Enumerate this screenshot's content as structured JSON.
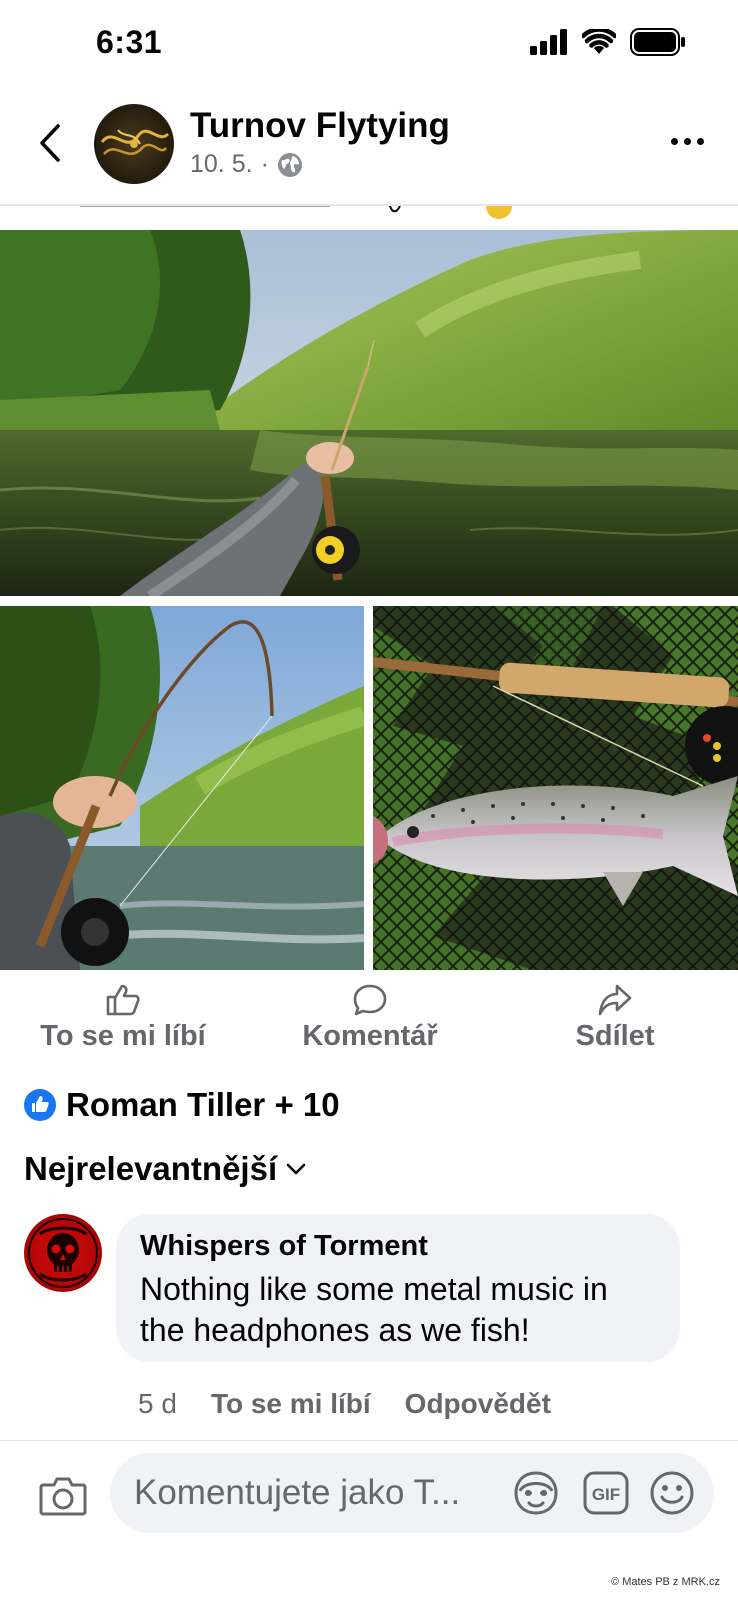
{
  "status_bar": {
    "time": "6:31"
  },
  "header": {
    "page_name": "Turnov Flytying",
    "date": "10. 5.",
    "separator": "·"
  },
  "photos": [
    {
      "icon": "river-fly-fishing-photo"
    },
    {
      "icon": "bent-rod-river-photo"
    },
    {
      "icon": "rainbow-trout-net-photo"
    }
  ],
  "actions": {
    "like": "To se mi líbí",
    "comment": "Komentář",
    "share": "Sdílet"
  },
  "reactions": {
    "text": "Roman Tiller + 10",
    "color": "#1877f2"
  },
  "sort": {
    "label": "Nejrelevantnější"
  },
  "comment": {
    "author": "Whispers of Torment",
    "text": "Nothing like some metal music in the headphones as we fish!",
    "time": "5 d",
    "like": "To se mi líbí",
    "reply": "Odpovědět"
  },
  "composer": {
    "placeholder": "Komentujete jako T...",
    "gif": "GIF"
  },
  "credit": "© Mates PB z MRK.cz"
}
